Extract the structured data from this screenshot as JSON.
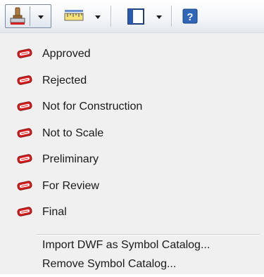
{
  "toolbar": {
    "buttons": [
      {
        "icon": "stamp-icon",
        "has_dropdown": true
      },
      {
        "icon": "ruler-icon",
        "has_dropdown": true
      },
      {
        "icon": "panel-icon",
        "has_dropdown": true
      },
      {
        "icon": "help-icon",
        "has_dropdown": false
      }
    ]
  },
  "menu": {
    "stamp_items": [
      {
        "label": "Approved",
        "icon": "stamp-badge-icon"
      },
      {
        "label": "Rejected",
        "icon": "stamp-badge-icon"
      },
      {
        "label": "Not for Construction",
        "icon": "stamp-badge-icon"
      },
      {
        "label": "Not to Scale",
        "icon": "stamp-badge-icon"
      },
      {
        "label": "Preliminary",
        "icon": "stamp-badge-icon"
      },
      {
        "label": "For Review",
        "icon": "stamp-badge-icon"
      },
      {
        "label": "Final",
        "icon": "stamp-badge-icon"
      }
    ],
    "actions": [
      {
        "label": "Import DWF as Symbol Catalog..."
      },
      {
        "label": "Remove Symbol Catalog..."
      }
    ]
  },
  "colors": {
    "stamp_red": "#d42020",
    "menu_background": "#f0f0f0",
    "help_blue": "#2f66b8"
  }
}
